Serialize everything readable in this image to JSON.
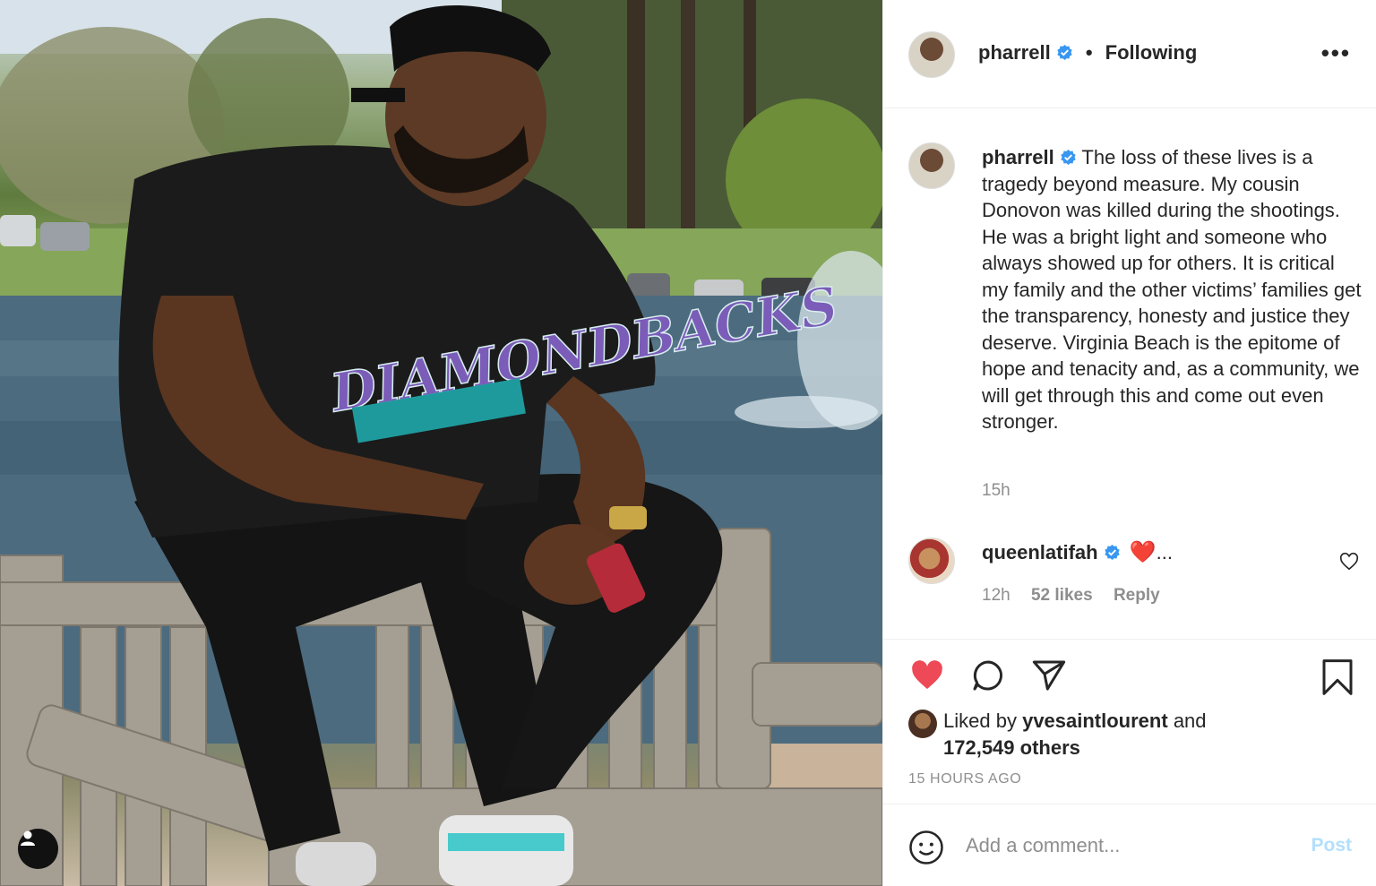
{
  "photo": {
    "jersey_top": "DIAMONDBACKS",
    "alt_subject": "Man in black baseball jersey sitting on wooden bench by pond"
  },
  "header": {
    "username": "pharrell",
    "separator": "•",
    "follow_state": "Following",
    "more_label": "•••"
  },
  "caption": {
    "username": "pharrell",
    "text": "The loss of these lives is a tragedy beyond measure. My cousin Donovon was killed during the shootings. He was a bright light and someone who always showed up for others. It is critical my family and the other victims’ families get the transparency, honesty and justice they deserve. Virginia Beach is the epitome of hope and tenacity and, as a community, we will get through this and come out even stronger.",
    "time": "15h"
  },
  "comment": {
    "username": "queenlatifah",
    "emoji": "❤️",
    "ellipsis": "...",
    "time": "12h",
    "likes": "52 likes",
    "reply": "Reply"
  },
  "likes": {
    "prefix": "Liked by",
    "user": "yvesaintlourent",
    "conjunction": "and",
    "others": "172,549 others"
  },
  "post_time": "15 HOURS AGO",
  "comment_box": {
    "placeholder": "Add a comment...",
    "post_label": "Post"
  },
  "colors": {
    "like_red": "#ed4956",
    "verified_blue": "#3897f0",
    "post_disabled": "#b2dffc",
    "muted": "#8e8e8e"
  }
}
